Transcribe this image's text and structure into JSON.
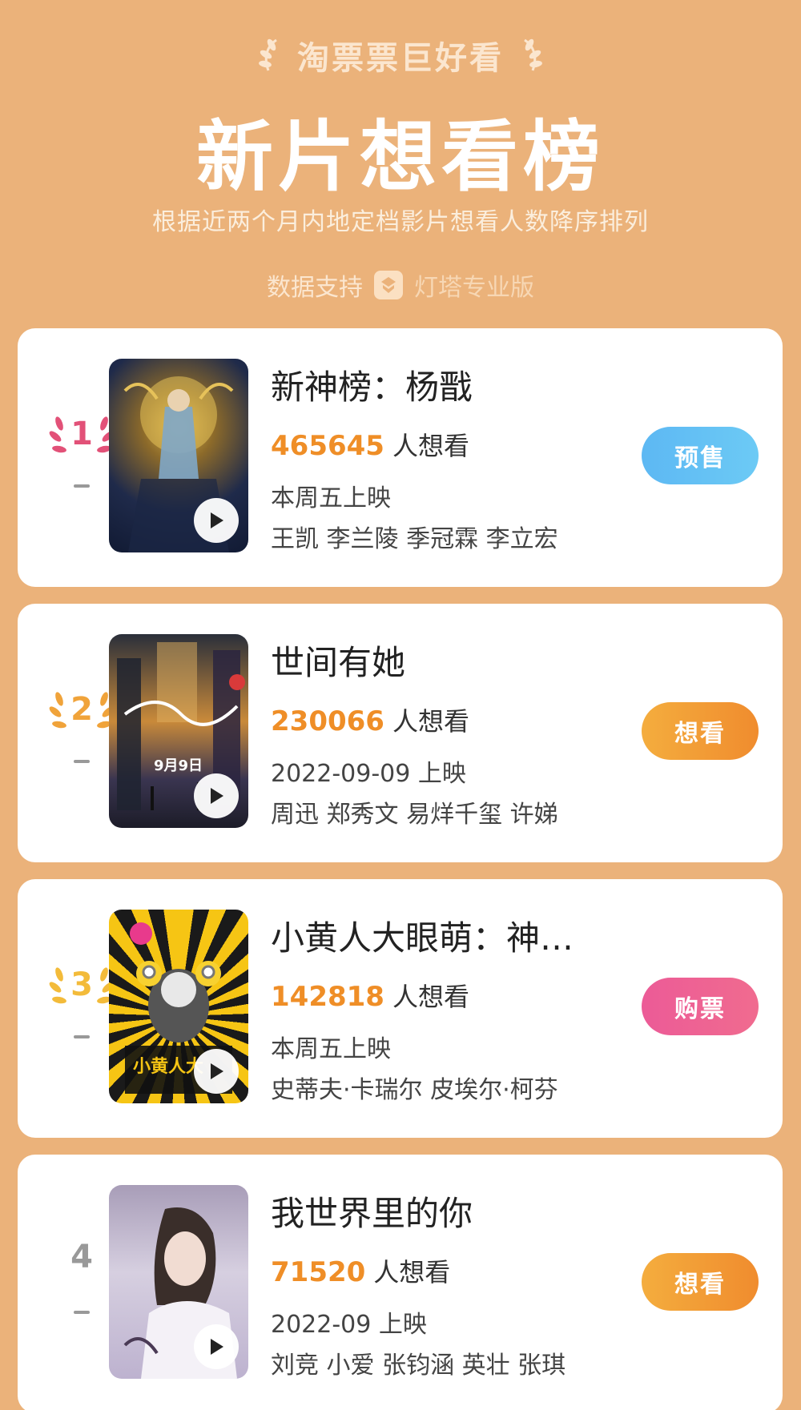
{
  "header": {
    "brand": "淘票票巨好看",
    "title": "新片想看榜",
    "subtitle": "根据近两个月内地定档影片想看人数降序排列",
    "support_label": "数据支持",
    "support_brand": "灯塔专业版"
  },
  "movies": [
    {
      "rank": "1",
      "title": "新神榜：杨戬",
      "want_count": "465645",
      "want_suffix": "人想看",
      "release": "本周五上映",
      "cast": "王凯 李兰陵 季冠霖 李立宏",
      "button": "预售",
      "button_color": "#5db8f3"
    },
    {
      "rank": "2",
      "title": "世间有她",
      "want_count": "230066",
      "want_suffix": "人想看",
      "release": "2022-09-09 上映",
      "cast": "周迅 郑秀文 易烊千玺 许娣",
      "button": "想看",
      "button_color": "#f2a038",
      "poster_text": "9月9日"
    },
    {
      "rank": "3",
      "title": "小黄人大眼萌：神…",
      "want_count": "142818",
      "want_suffix": "人想看",
      "release": "本周五上映",
      "cast": "史蒂夫·卡瑞尔 皮埃尔·柯芬",
      "button": "购票",
      "button_color": "#ec5b97",
      "poster_text": "小黄人大"
    },
    {
      "rank": "4",
      "title": "我世界里的你",
      "want_count": "71520",
      "want_suffix": "人想看",
      "release": "2022-09 上映",
      "cast": "刘竞 小爱 张钧涵 英壮 张琪",
      "button": "想看",
      "button_color": "#f2a038"
    }
  ]
}
